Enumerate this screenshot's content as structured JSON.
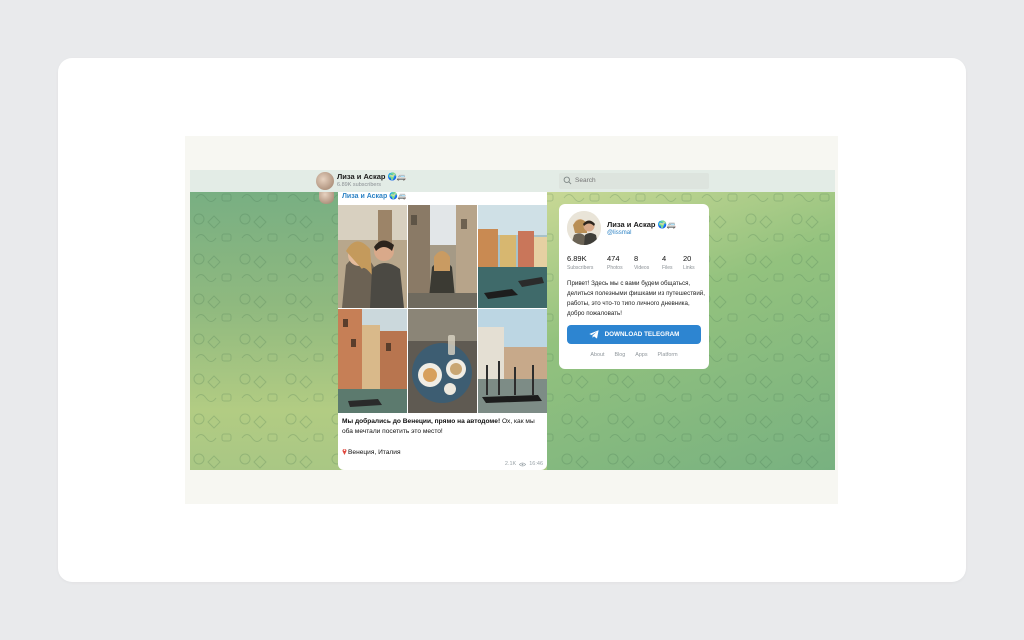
{
  "channel": {
    "title": "Лиза и Аскар 🌍🚐",
    "subscribers_text": "6.89K subscribers",
    "handle": "@lissmal"
  },
  "search": {
    "placeholder": "Search"
  },
  "post": {
    "author": "Лиза и Аскар 🌍🚐",
    "caption_bold": "Мы добрались до Венеции, прямо на автодоме!",
    "caption_rest": " Ох, как мы оба мечтали посетить это место!",
    "location": "Венеция, Италия",
    "views": "2.1K",
    "time": "16:46",
    "photos": [
      "selfie-couple",
      "woman-canal-street",
      "canal-boats",
      "canal-houses",
      "table-food",
      "gondolas-pier"
    ]
  },
  "profile": {
    "name": "Лиза и Аскар 🌍🚐",
    "handle": "@lissmal",
    "stats": [
      {
        "value": "6.89K",
        "label": "Subscribers"
      },
      {
        "value": "474",
        "label": "Photos"
      },
      {
        "value": "8",
        "label": "Videos"
      },
      {
        "value": "4",
        "label": "Files"
      },
      {
        "value": "20",
        "label": "Links"
      }
    ],
    "description": "Привет! Здесь мы с вами будем общаться, делиться полезными фишками из путешествий, работы, это что-то типо личного дневника, добро пожаловать!",
    "download_label": "DOWNLOAD TELEGRAM",
    "links": [
      "About",
      "Blog",
      "Apps",
      "Platform"
    ]
  },
  "colors": {
    "accent": "#2d85d1",
    "link": "#2d83c5",
    "chat_bg": "#8fb97f"
  }
}
